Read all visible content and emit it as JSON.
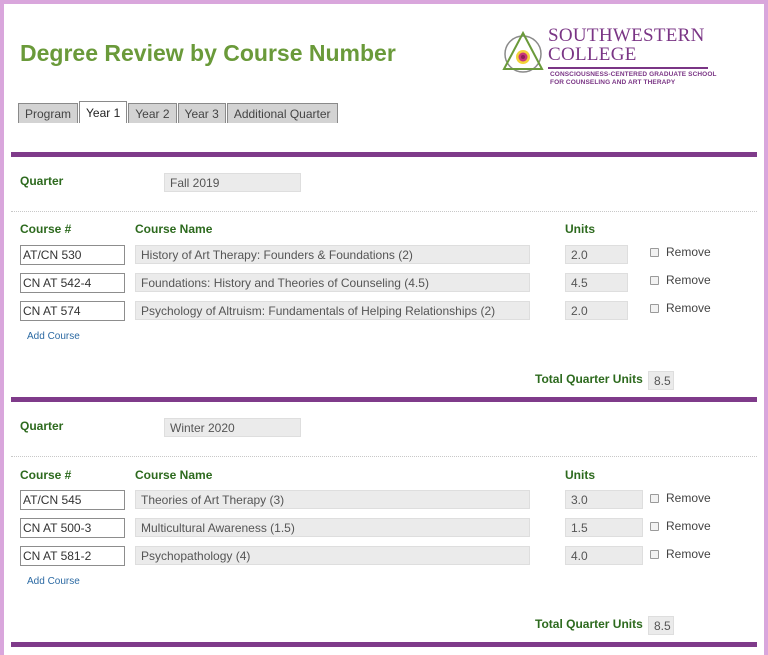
{
  "page": {
    "title": "Degree Review by Course Number"
  },
  "logo": {
    "name_line1": "SOUTHWESTERN",
    "name_line2": "COLLEGE",
    "sub_line1": "CONSCIOUSNESS-CENTERED GRADUATE SCHOOL",
    "sub_line2": "FOR COUNSELING AND ART THERAPY"
  },
  "tabs": [
    {
      "label": "Program",
      "active": false
    },
    {
      "label": "Year 1",
      "active": true
    },
    {
      "label": "Year 2",
      "active": false
    },
    {
      "label": "Year 3",
      "active": false
    },
    {
      "label": "Additional Quarter",
      "active": false
    }
  ],
  "labels": {
    "quarter": "Quarter",
    "course_num": "Course #",
    "course_name": "Course Name",
    "units": "Units",
    "remove": "Remove",
    "add_course": "Add Course",
    "total_units": "Total Quarter Units"
  },
  "quarters": [
    {
      "name": "Fall 2019",
      "total_units": "8.5",
      "courses": [
        {
          "number": "AT/CN 530",
          "name": "History of Art Therapy: Founders & Foundations (2)",
          "units": "2.0"
        },
        {
          "number": "CN AT 542-4",
          "name": "Foundations: History and Theories of Counseling (4.5)",
          "units": "4.5"
        },
        {
          "number": "CN AT 574",
          "name": "Psychology of Altruism: Fundamentals of Helping Relationships (2)",
          "units": "2.0"
        }
      ]
    },
    {
      "name": "Winter 2020",
      "total_units": "8.5",
      "courses": [
        {
          "number": "AT/CN 545",
          "name": "Theories of Art Therapy (3)",
          "units": "3.0"
        },
        {
          "number": "CN AT 500-3",
          "name": "Multicultural Awareness (1.5)",
          "units": "1.5"
        },
        {
          "number": "CN AT 581-2",
          "name": "Psychopathology (4)",
          "units": "4.0"
        }
      ]
    }
  ]
}
